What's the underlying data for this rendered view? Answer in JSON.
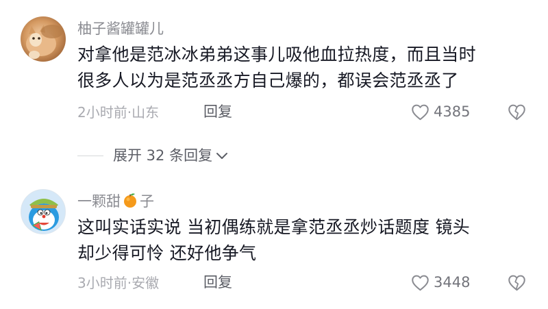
{
  "comments": [
    {
      "username": "柚子酱罐罐儿",
      "content_line1": "对拿他是范冰冰弟弟这事儿吸他血拉热度，而且当时",
      "content_line2": "很多人以为是范丞丞方自己爆的，都误会范丞丞了",
      "meta": "2小时前·山东",
      "reply_label": "回复",
      "likes": "4385",
      "avatar_icon": "cat-photo"
    },
    {
      "username_part1": "一颗甜",
      "username_part2": "子",
      "username_emoji": "orange",
      "content_line1": "这叫实话实说 当初偶练就是拿范丞丞炒话题度 镜头",
      "content_line2": "却少得可怜 还好他争气",
      "meta": "3小时前·安徽",
      "reply_label": "回复",
      "likes": "3448",
      "avatar_icon": "cartoon-doraemon"
    }
  ],
  "expand_replies": {
    "label": "展开 32 条回复"
  },
  "colors": {
    "text": "#161823",
    "secondary": "#8a8b91",
    "meta": "#a9aab0"
  }
}
